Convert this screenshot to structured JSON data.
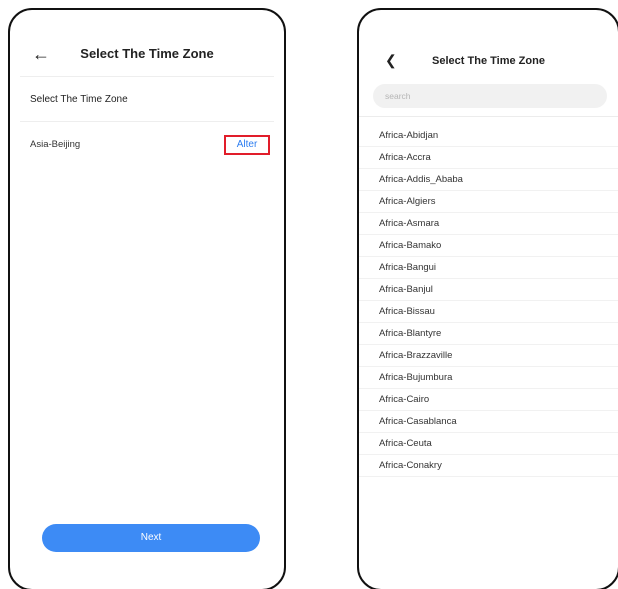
{
  "left_screen": {
    "header": {
      "back_icon": "arrow-left-icon",
      "title": "Select The Time Zone"
    },
    "section_label": "Select The Time Zone",
    "current_zone": "Asia-Beijing",
    "alter_label": "Alter",
    "highlight_color": "#e11d2a",
    "next_label": "Next",
    "accent_color": "#3d8bf5"
  },
  "right_screen": {
    "header": {
      "back_icon": "chevron-left-icon",
      "title": "Select The Time Zone"
    },
    "search": {
      "placeholder": "search",
      "value": ""
    },
    "zones": [
      "Africa-Abidjan",
      "Africa-Accra",
      "Africa-Addis_Ababa",
      "Africa-Algiers",
      "Africa-Asmara",
      "Africa-Bamako",
      "Africa-Bangui",
      "Africa-Banjul",
      "Africa-Bissau",
      "Africa-Blantyre",
      "Africa-Brazzaville",
      "Africa-Bujumbura",
      "Africa-Cairo",
      "Africa-Casablanca",
      "Africa-Ceuta",
      "Africa-Conakry"
    ]
  }
}
